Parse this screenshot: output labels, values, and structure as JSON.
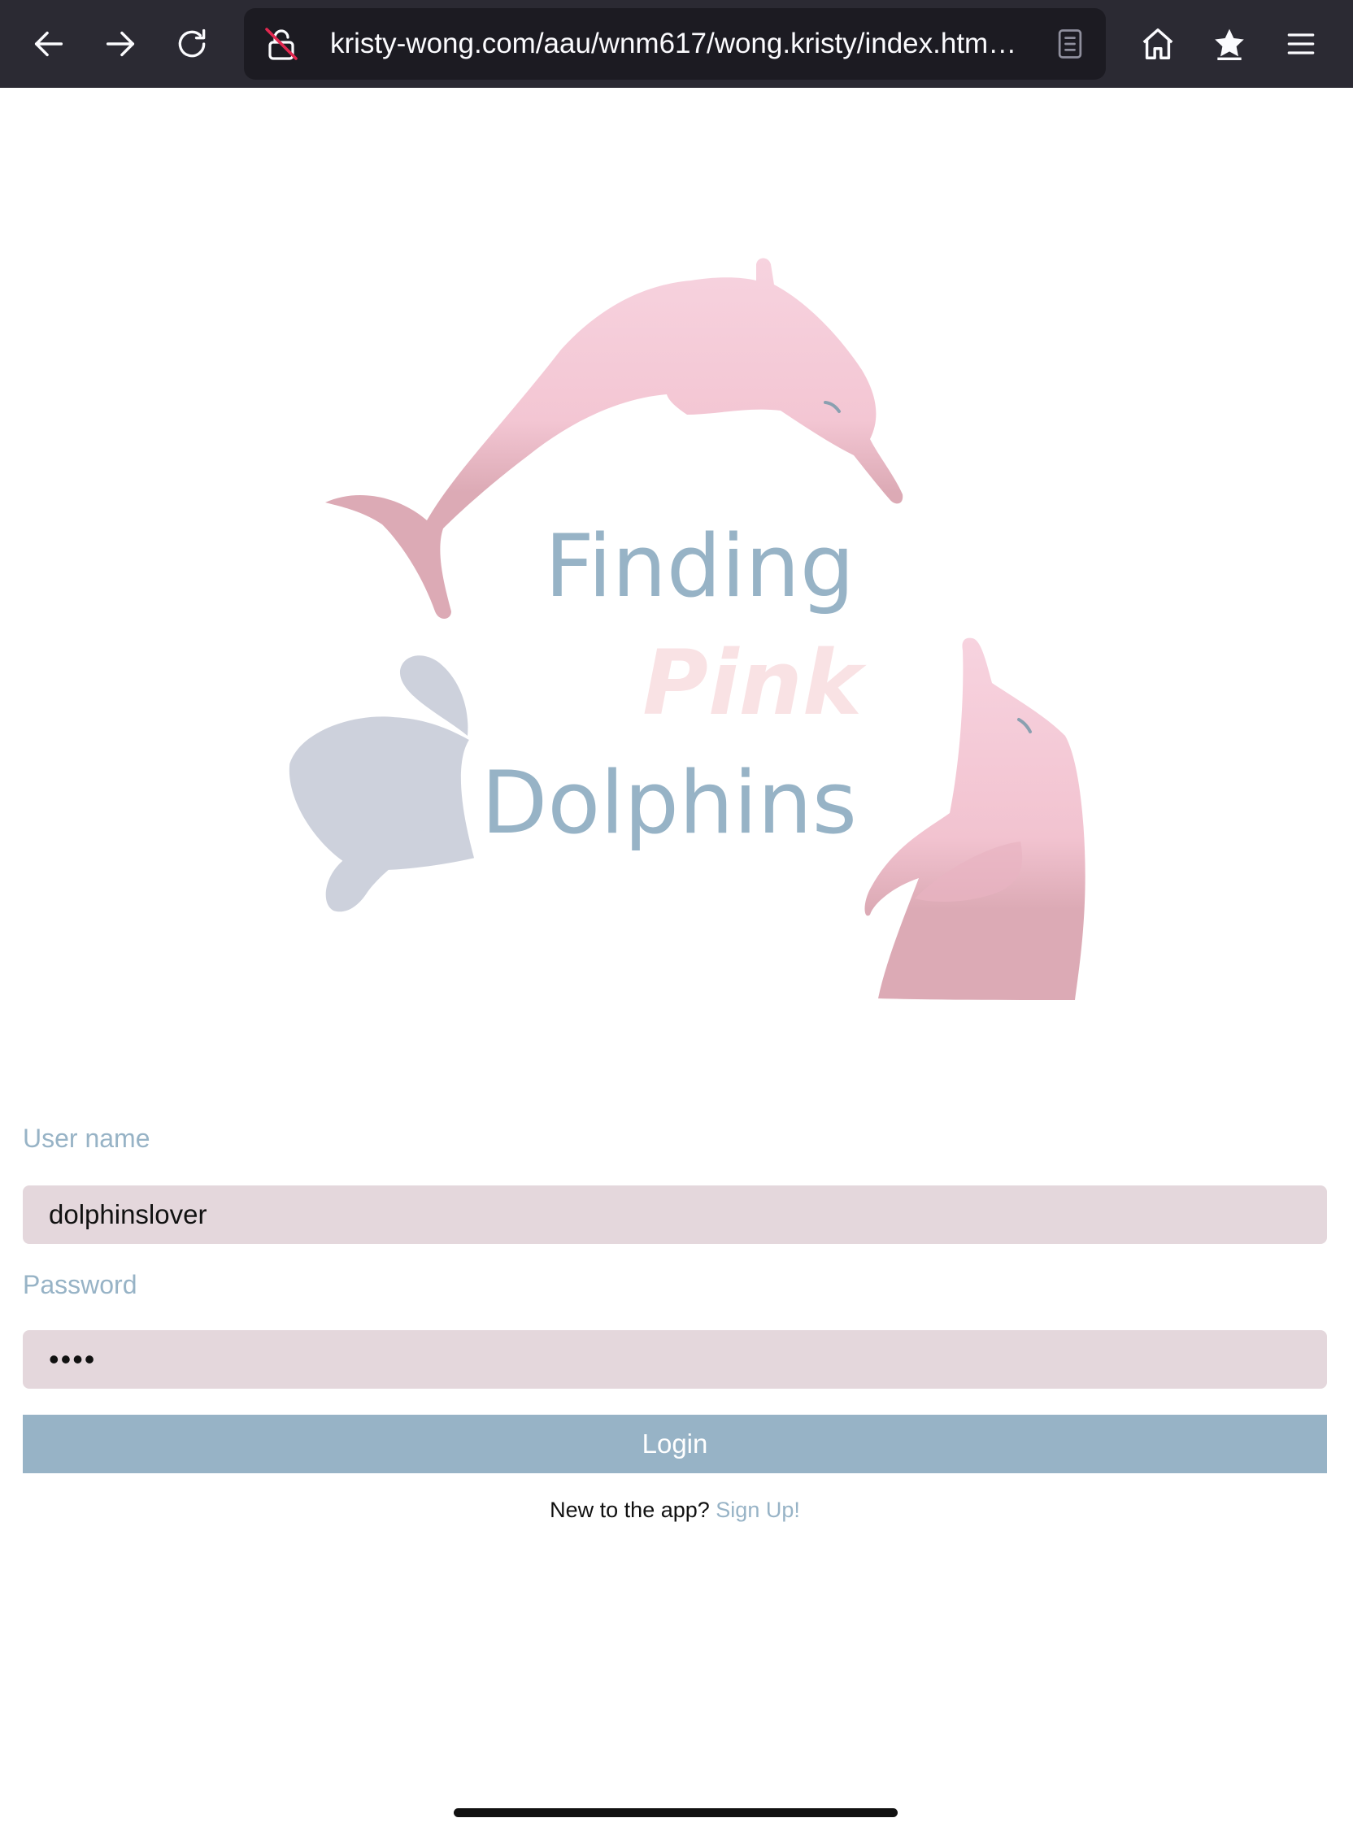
{
  "browser": {
    "url": "kristy-wong.com/aau/wnm617/wong.kristy/index.html#s...",
    "icons": {
      "back": "arrow-left-icon",
      "forward": "arrow-right-icon",
      "reload": "reload-icon",
      "insecure": "lock-insecure-icon",
      "reader": "reader-mode-icon",
      "home": "home-icon",
      "bookmarks": "star-icon",
      "menu": "hamburger-menu-icon"
    }
  },
  "logo": {
    "line1": "Finding",
    "line2": "Pink",
    "line3": "Dolphins"
  },
  "login_form": {
    "username_label": "User name",
    "username_value": "dolphinslover",
    "password_label": "Password",
    "password_value": "abcd",
    "login_label": "Login",
    "signup_prompt": "New to the app?",
    "signup_link": "Sign Up!"
  },
  "colors": {
    "accent_blue": "#97b3c6",
    "dolphin_pink": "#f3c6d3",
    "field_bg": "#e4d7dc",
    "toolbar_bg": "#2b2a33"
  }
}
